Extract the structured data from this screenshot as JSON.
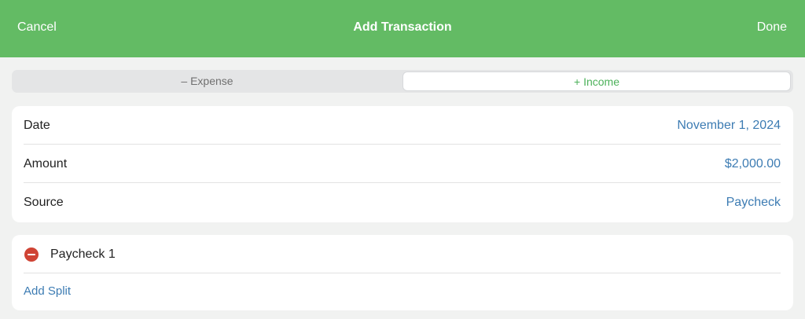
{
  "navbar": {
    "cancel_label": "Cancel",
    "title": "Add Transaction",
    "done_label": "Done",
    "background_color": "#63bb64"
  },
  "type_selector": {
    "expense_label": "– Expense",
    "income_label": "+ Income",
    "selected": "income",
    "income_color": "#4cb15a"
  },
  "details": {
    "date": {
      "label": "Date",
      "value": "November 1, 2024"
    },
    "amount": {
      "label": "Amount",
      "value": "$2,000.00"
    },
    "source": {
      "label": "Source",
      "value": "Paycheck"
    },
    "value_color": "#3d7cb3"
  },
  "splits": {
    "items": [
      {
        "name": "Paycheck 1",
        "icon": "remove-circle-icon"
      }
    ],
    "add_label": "Add Split",
    "remove_color": "#cf4334"
  }
}
